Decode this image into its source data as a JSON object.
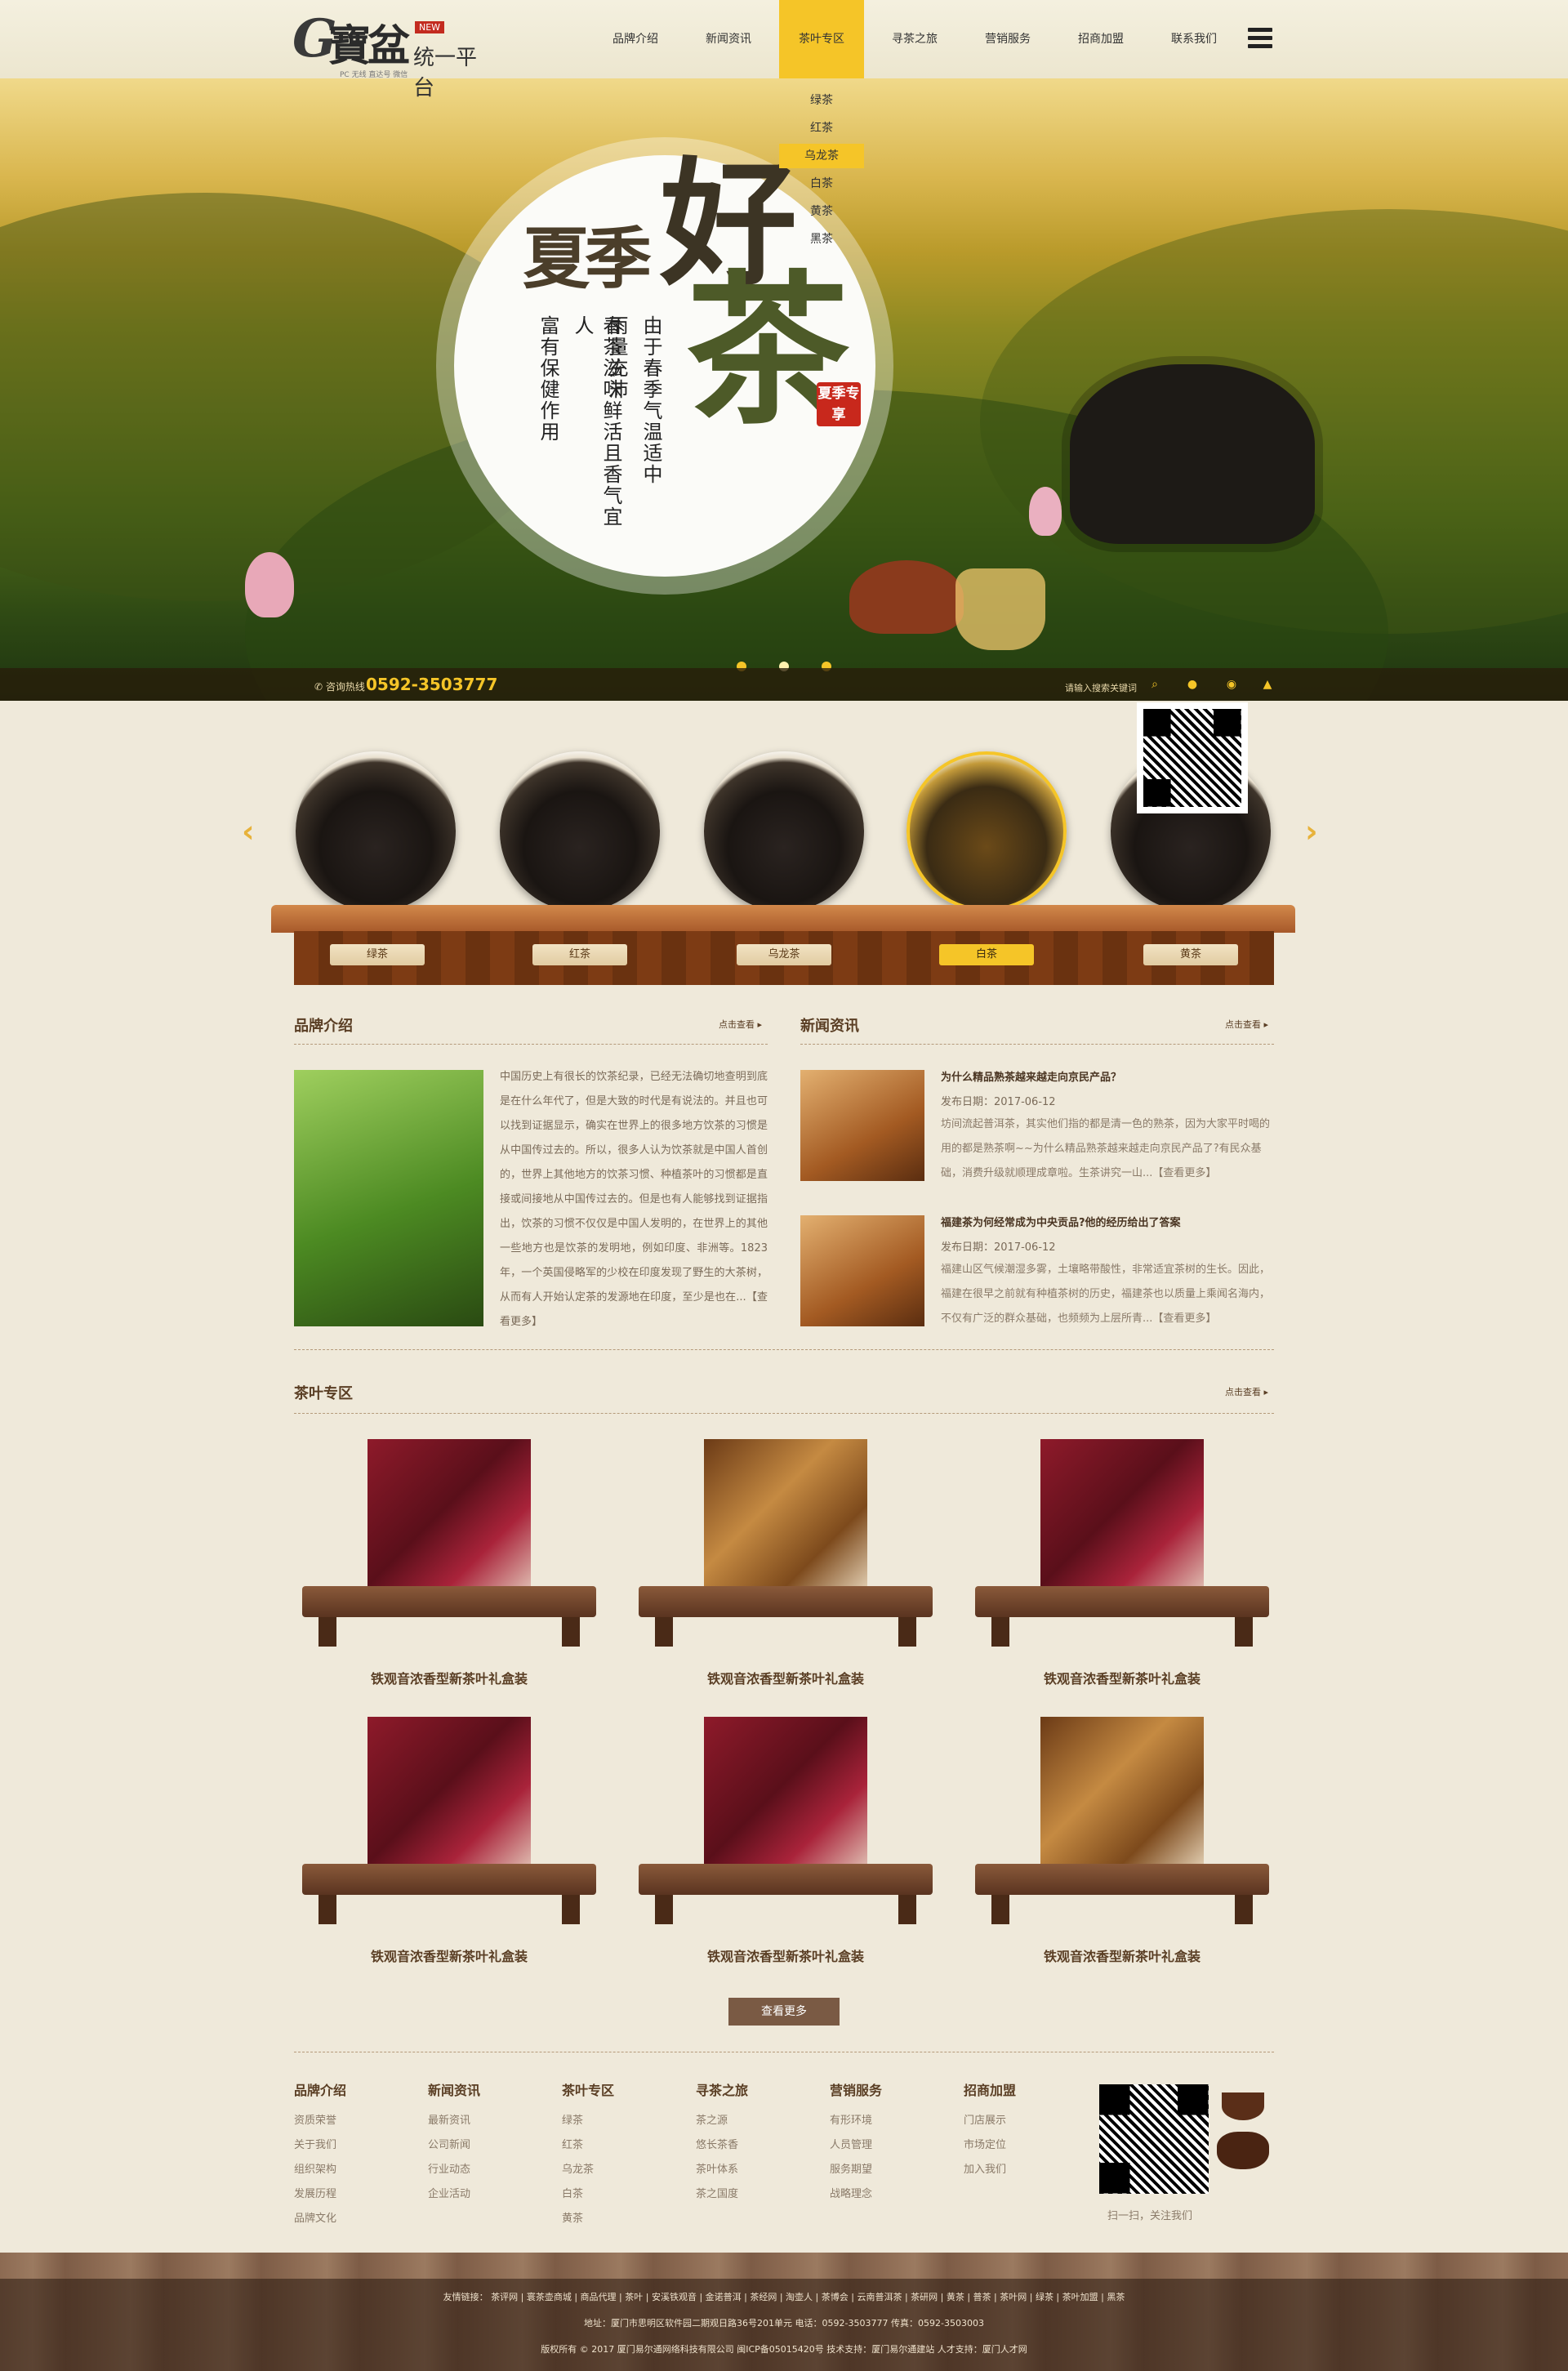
{
  "header": {
    "logo_g": "G",
    "logo_cn": "寶盆",
    "logo_badge": "NEW",
    "logo_platform": "统一平台",
    "logo_sub": "PC 无线 直达号 微信",
    "nav": [
      "品牌介绍",
      "新闻资讯",
      "茶叶专区",
      "寻茶之旅",
      "营销服务",
      "招商加盟",
      "联系我们"
    ],
    "nav_active": "茶叶专区",
    "dropdown": [
      "绿茶",
      "红茶",
      "乌龙茶",
      "白茶",
      "黄茶",
      "黑茶"
    ],
    "dropdown_active": "乌龙茶"
  },
  "hero": {
    "title_summer": "夏季",
    "title_good": "好",
    "title_tea": "茶",
    "vertical_lines": [
      "由于春季气温适中",
      "雨量充沛",
      "春茶滋味鲜活且香气宜人",
      "富有保健作用"
    ],
    "seal": "夏季专享",
    "hotline_label": "咨询热线",
    "hotline": "0592-3503777",
    "search_hint": "请输入搜索关键词",
    "slide_count": 3,
    "slide_active": 2
  },
  "categories": {
    "items": [
      "绿茶",
      "红茶",
      "乌龙茶",
      "白茶",
      "黄茶"
    ],
    "active": "白茶",
    "prev_icon": "chevron-left-icon",
    "next_icon": "chevron-right-icon"
  },
  "brand": {
    "title": "品牌介绍",
    "more": "点击查看 ▸",
    "text": "中国历史上有很长的饮茶纪录，已经无法确切地查明到底是在什么年代了，但是大致的时代是有说法的。并且也可以找到证据显示，确实在世界上的很多地方饮茶的习惯是从中国传过去的。所以，很多人认为饮茶就是中国人首创的，世界上其他地方的饮茶习惯、种植茶叶的习惯都是直接或间接地从中国传过去的。但是也有人能够找到证据指出，饮茶的习惯不仅仅是中国人发明的，在世界上的其他一些地方也是饮茶的发明地，例如印度、非洲等。1823年，一个英国侵略军的少校在印度发现了野生的大茶树，从而有人开始认定茶的发源地在印度，至少是也在...【查看更多】"
  },
  "news": {
    "title": "新闻资讯",
    "more": "点击查看 ▸",
    "items": [
      {
        "title": "为什么精品熟茶越来越走向京民产品？",
        "date": "发布日期：2017-06-12",
        "body": "坊间流起普洱茶，其实他们指的都是清一色的熟茶，因为大家平时喝的用的都是熟茶啊~~为什么精品熟茶越来越走向京民产品了?有民众基础，消费升级就顺理成章啦。生茶讲究一山...【查看更多】"
      },
      {
        "title": "福建茶为何经常成为中央贡品?他的经历给出了答案",
        "date": "发布日期：2017-06-12",
        "body": "福建山区气候潮湿多雾，土壤略带酸性，非常适宜茶树的生长。因此，福建在很早之前就有种植茶树的历史，福建茶也以质量上乘闻名海内，不仅有广泛的群众基础，也频频为上层所青...【查看更多】"
      }
    ]
  },
  "products": {
    "title": "茶叶专区",
    "more": "点击查看 ▸",
    "items": [
      {
        "name": "铁观音浓香型新茶叶礼盒装"
      },
      {
        "name": "铁观音浓香型新茶叶礼盒装"
      },
      {
        "name": "铁观音浓香型新茶叶礼盒装"
      },
      {
        "name": "铁观音浓香型新茶叶礼盒装"
      },
      {
        "name": "铁观音浓香型新茶叶礼盒装"
      },
      {
        "name": "铁观音浓香型新茶叶礼盒装"
      }
    ],
    "more_button": "查看更多"
  },
  "footer": {
    "columns": [
      {
        "title": "品牌介绍",
        "items": [
          "资质荣誉",
          "关于我们",
          "组织架构",
          "发展历程",
          "品牌文化"
        ]
      },
      {
        "title": "新闻资讯",
        "items": [
          "最新资讯",
          "公司新闻",
          "行业动态",
          "企业活动"
        ]
      },
      {
        "title": "茶叶专区",
        "items": [
          "绿茶",
          "红茶",
          "乌龙茶",
          "白茶",
          "黄茶"
        ]
      },
      {
        "title": "寻茶之旅",
        "items": [
          "茶之源",
          "悠长茶香",
          "茶叶体系",
          "茶之国度"
        ]
      },
      {
        "title": "营销服务",
        "items": [
          "有形环境",
          "人员管理",
          "服务期望",
          "战略理念"
        ]
      },
      {
        "title": "招商加盟",
        "items": [
          "门店展示",
          "市场定位",
          "加入我们"
        ]
      }
    ],
    "qr_caption": "扫一扫，关注我们",
    "links": "友情链接：   茶评网   |   寰茶壶商城   |   商品代理   |   茶叶   |   安溪铁观音   |   金诺普洱   |   茶经网   |   淘壶人   |   茶博会   |   云南普洱茶   |   茶研网   |   黄茶   |   普茶   |   茶叶网   |   绿茶   |   茶叶加盟   |   黑茶",
    "address": "地址：厦门市思明区软件园二期观日路36号201单元    电话：0592-3503777    传真：0592-3503003",
    "copyright": "版权所有 © 2017 厦门易尔通网络科技有限公司   闽ICP备05015420号   技术支持：厦门易尔通建站   人才支持：厦门人才网"
  },
  "colors": {
    "accent": "#f5c528",
    "brown": "#5a3e24",
    "paper": "#efe9da"
  }
}
